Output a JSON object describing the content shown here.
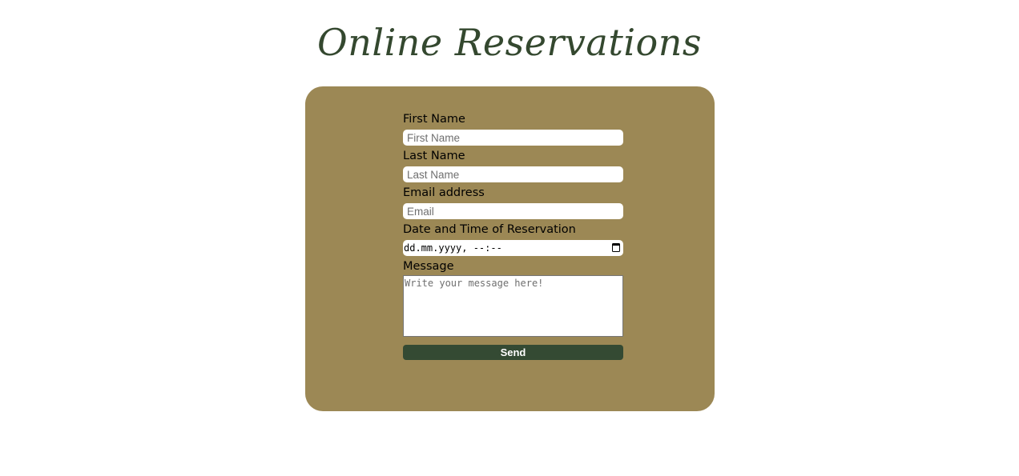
{
  "page": {
    "title": "Online Reservations"
  },
  "form": {
    "first_name": {
      "label": "First Name",
      "placeholder": "First Name",
      "value": ""
    },
    "last_name": {
      "label": "Last Name",
      "placeholder": "Last Name",
      "value": ""
    },
    "email": {
      "label": "Email address",
      "placeholder": "Email",
      "value": ""
    },
    "datetime": {
      "label": "Date and Time of Reservation",
      "display": "dd.mm.yyyy, --:--",
      "icon": "calendar-icon"
    },
    "message": {
      "label": "Message",
      "placeholder": "Write your message here!",
      "value": ""
    },
    "submit_label": "Send"
  },
  "colors": {
    "title": "#34482f",
    "card_background": "#9c8855",
    "button_background": "#344a33",
    "button_text": "#ffffff",
    "page_background": "#ffffff"
  }
}
